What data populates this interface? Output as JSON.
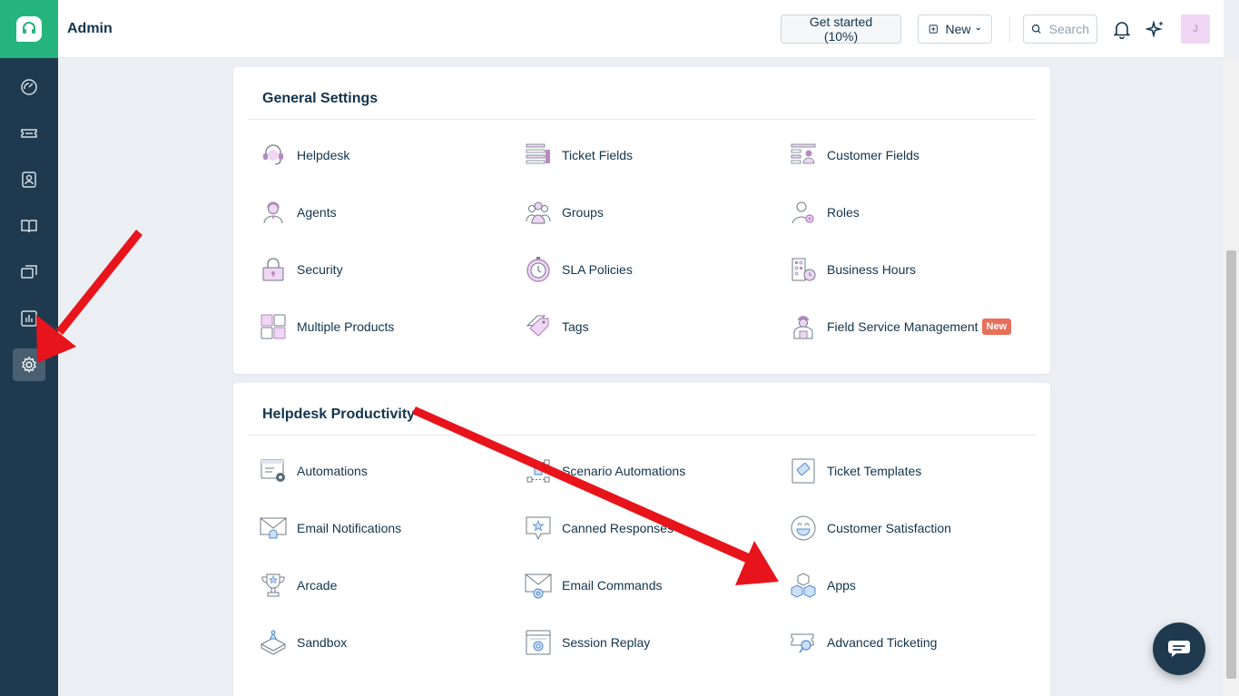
{
  "header": {
    "title": "Admin",
    "get_started_label": "Get started (10%)",
    "new_label": "New",
    "search_placeholder": "Search",
    "avatar_initial": "J"
  },
  "sidebar": {
    "items": [
      {
        "name": "dashboard",
        "icon": "gauge-icon"
      },
      {
        "name": "tickets",
        "icon": "ticket-icon"
      },
      {
        "name": "contacts",
        "icon": "contact-icon"
      },
      {
        "name": "solutions",
        "icon": "book-icon"
      },
      {
        "name": "forums",
        "icon": "chat-icon"
      },
      {
        "name": "analytics",
        "icon": "bar-chart-icon"
      },
      {
        "name": "admin",
        "icon": "gear-icon",
        "active": true
      }
    ]
  },
  "general_settings": {
    "title": "General Settings",
    "items": [
      "Helpdesk",
      "Ticket Fields",
      "Customer Fields",
      "Agents",
      "Groups",
      "Roles",
      "Security",
      "SLA Policies",
      "Business Hours",
      "Multiple Products",
      "Tags",
      "Field Service Management"
    ],
    "new_badge": "New"
  },
  "helpdesk_productivity": {
    "title": "Helpdesk Productivity",
    "items": [
      "Automations",
      "Scenario Automations",
      "Ticket Templates",
      "Email Notifications",
      "Canned Responses",
      "Customer Satisfaction",
      "Arcade",
      "Email Commands",
      "Apps",
      "Sandbox",
      "Session Replay",
      "Advanced Ticketing"
    ]
  },
  "colors": {
    "sidebar": "#1f3a4e",
    "brand": "#25b47c",
    "accent_purple": "#b78bc2",
    "arrow": "#e8141b",
    "badge": "#e86f5b"
  }
}
